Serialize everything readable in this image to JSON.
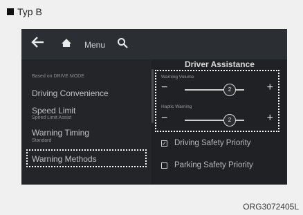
{
  "header": {
    "corner_text": "",
    "section_title": "Typ B"
  },
  "topbar": {
    "menu_label": "Menu"
  },
  "left_pane": {
    "caption": "Based on DRIVE MODE",
    "items": [
      {
        "label": "Driving Convenience",
        "sub": ""
      },
      {
        "label": "Speed Limit",
        "sub": "Speed Limit Assist"
      },
      {
        "label": "Warning Timing",
        "sub": "Standard"
      },
      {
        "label": "Warning Methods",
        "sub": ""
      }
    ]
  },
  "right_pane": {
    "title": "Driver Assistance",
    "warning_volume": {
      "label": "Warning Volume",
      "value": "2"
    },
    "haptic_warning": {
      "label": "Haptic Warning",
      "value": "2"
    },
    "options": [
      {
        "label": "Driving Safety Priority",
        "checked": true
      },
      {
        "label": "Parking Safety Priority",
        "checked": false
      }
    ]
  },
  "footer": {
    "code": "ORG3072405L"
  }
}
